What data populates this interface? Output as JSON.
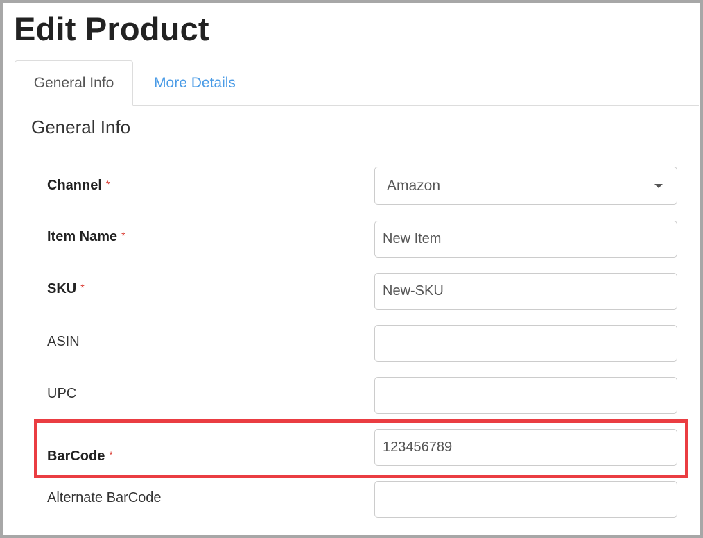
{
  "page": {
    "title": "Edit Product"
  },
  "tabs": [
    {
      "label": "General Info",
      "active": true
    },
    {
      "label": "More Details",
      "active": false
    }
  ],
  "section": {
    "heading": "General Info"
  },
  "form": {
    "required_marker": "*",
    "channel": {
      "label": "Channel",
      "value": "Amazon",
      "required": true
    },
    "item_name": {
      "label": "Item Name",
      "value": "New Item",
      "required": true
    },
    "sku": {
      "label": "SKU",
      "value": "New-SKU",
      "required": true
    },
    "asin": {
      "label": "ASIN",
      "value": "",
      "required": false
    },
    "upc": {
      "label": "UPC",
      "value": "",
      "required": false
    },
    "barcode": {
      "label": "BarCode",
      "value": "123456789",
      "required": true
    },
    "alt_barcode": {
      "label": "Alternate BarCode",
      "value": "",
      "required": false
    }
  },
  "colors": {
    "link": "#4a9be6",
    "required_star": "#d9342b",
    "highlight": "#ea3d42",
    "frame": "#a7a7a7"
  }
}
